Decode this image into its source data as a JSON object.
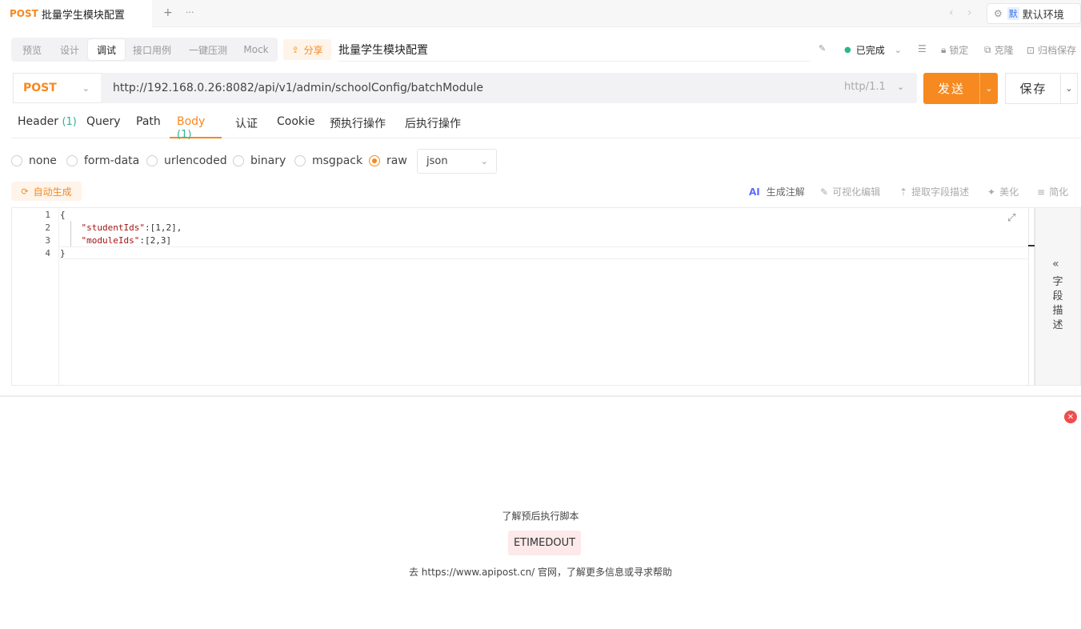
{
  "tab": {
    "method": "POST",
    "name": "批量学生模块配置"
  },
  "strip": {
    "add": "+",
    "more": "···",
    "prev": "‹",
    "next": "›"
  },
  "env": {
    "badge": "默",
    "label": "默认环境",
    "chev": "⌄",
    "gear": "⚙"
  },
  "modes": [
    "预览",
    "设计",
    "调试",
    "接口用例",
    "一键压测",
    "Mock"
  ],
  "share": "分享",
  "api_name": "批量学生模块配置",
  "toolbar": {
    "status": "已完成",
    "lock": "锁定",
    "clone": "克隆",
    "archive": "归档保存",
    "status_color": "#2cb68f"
  },
  "request": {
    "method": "POST",
    "url": "http://192.168.0.26:8082/api/v1/admin/schoolConfig/batchModule",
    "protocol": "http/1.1",
    "send": "发送",
    "save": "保存"
  },
  "req_tabs": [
    {
      "label": "Header",
      "count": "(1)"
    },
    {
      "label": "Query",
      "count": ""
    },
    {
      "label": "Path",
      "count": ""
    },
    {
      "label": "Body",
      "count": "(1)"
    },
    {
      "label": "认证",
      "count": ""
    },
    {
      "label": "Cookie",
      "count": ""
    },
    {
      "label": "预执行操作",
      "count": ""
    },
    {
      "label": "后执行操作",
      "count": ""
    }
  ],
  "body_types": [
    "none",
    "form-data",
    "urlencoded",
    "binary",
    "msgpack",
    "raw"
  ],
  "body_format": "json",
  "editor_tools": {
    "auto": "自动生成",
    "ai": "AI",
    "gen_comment": "生成注解",
    "visual": "可视化编辑",
    "extract": "提取字段描述",
    "beautify": "美化",
    "simplify": "简化"
  },
  "code_lines": [
    {
      "n": "1",
      "t": "{"
    },
    {
      "n": "2",
      "k": "\"studentIds\"",
      "v": ":[1,2],"
    },
    {
      "n": "3",
      "k": "\"moduleIds\"",
      "v": ":[2,3]"
    },
    {
      "n": "4",
      "t": "}"
    }
  ],
  "side_panel": {
    "arrow": "«",
    "label": "字段描述"
  },
  "response": {
    "learn": "了解预后执行脚本",
    "error": "ETIMEDOUT",
    "help": "去 https://www.apipost.cn/ 官网，了解更多信息或寻求帮助"
  },
  "colors": {
    "accent": "#f6891f",
    "count": "#2cb68f",
    "error_bg": "#fde9e9",
    "close": "#f04d4d"
  }
}
